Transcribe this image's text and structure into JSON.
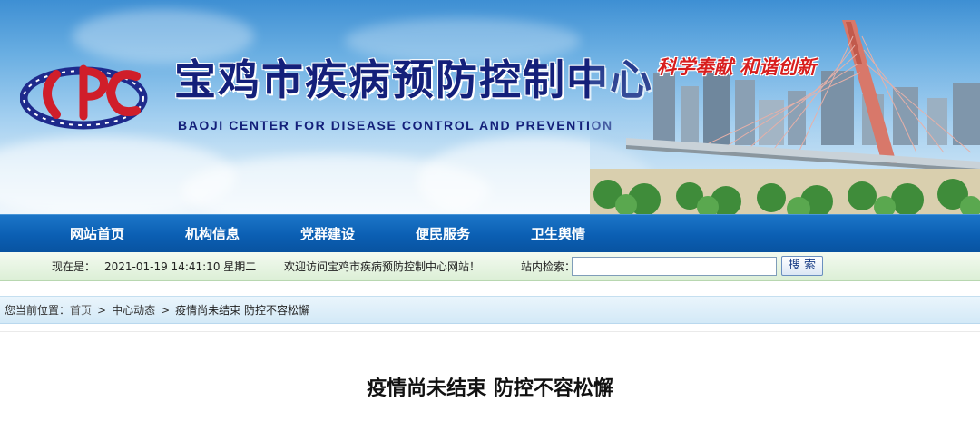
{
  "site": {
    "name_cn": "宝鸡市疾病预防控制中心",
    "name_en": "BAOJI CENTER FOR DISEASE CONTROL AND PREVENTION",
    "logo_text": "CDC",
    "slogan": "科学奉献  和谐创新"
  },
  "nav": {
    "items": [
      {
        "label": "网站首页"
      },
      {
        "label": "机构信息"
      },
      {
        "label": "党群建设"
      },
      {
        "label": "便民服务"
      },
      {
        "label": "卫生舆情"
      }
    ]
  },
  "infobar": {
    "now_label": "现在是：",
    "datetime": "2021-01-19 14:41:10 星期二",
    "welcome": "欢迎访问宝鸡市疾病预防控制中心网站！",
    "search_label": "站内检索：",
    "search_value": "",
    "search_button": "搜 索"
  },
  "breadcrumb": {
    "prefix": "您当前位置：",
    "home": "首页",
    "section": "中心动态",
    "current": "疫情尚未结束  防控不容松懈",
    "separator": ">"
  },
  "article": {
    "title": "疫情尚未结束  防控不容松懈"
  },
  "colors": {
    "nav_bg": "#0b5fb3",
    "title_navy": "#14207a",
    "slogan_red": "#d81e1e",
    "infobar_bg": "#dcefd6",
    "breadcrumb_bg": "#d3e9f7"
  }
}
